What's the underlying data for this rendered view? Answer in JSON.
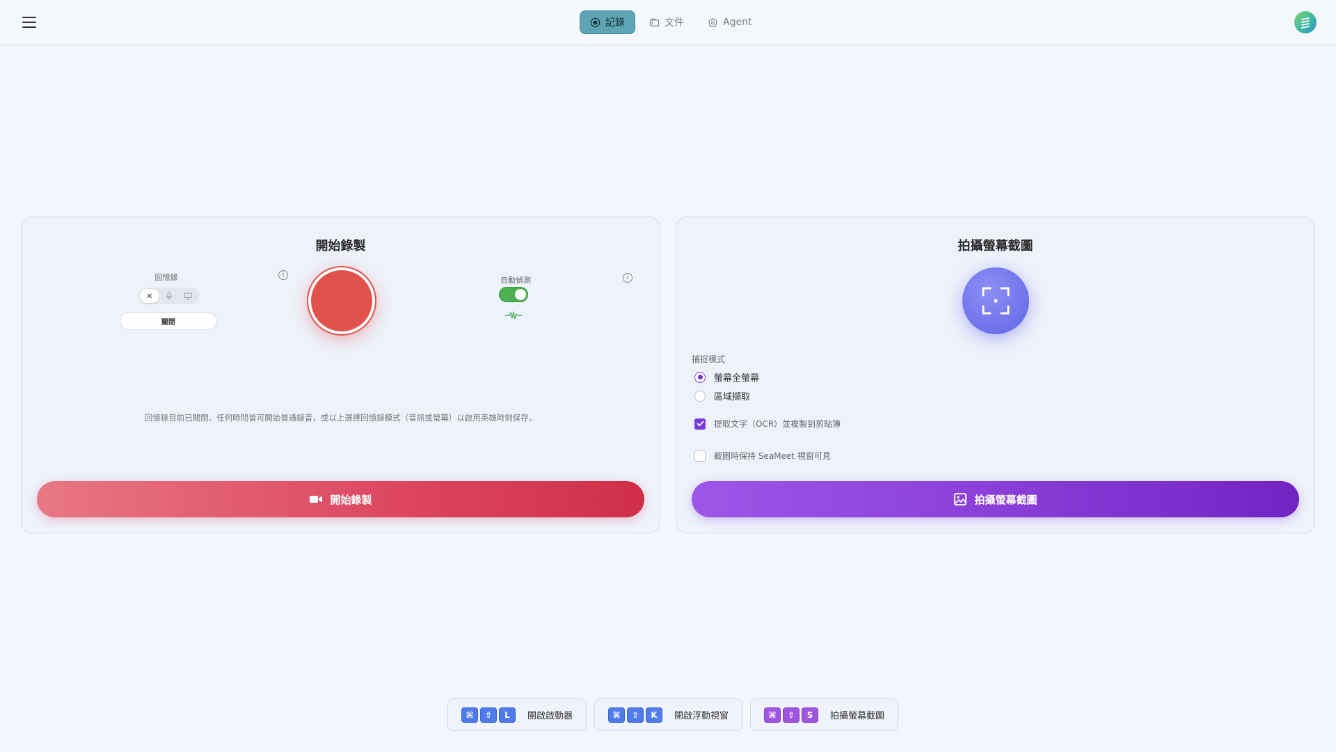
{
  "header": {
    "tabs": [
      {
        "label": "記錄",
        "icon": "record-icon",
        "active": true
      },
      {
        "label": "文件",
        "icon": "folder-icon",
        "active": false
      },
      {
        "label": "Agent",
        "icon": "agent-icon",
        "active": false
      }
    ],
    "menu_icon": "hamburger-menu-icon",
    "avatar_icon": "app-logo-avatar"
  },
  "record_card": {
    "title": "開始錄製",
    "recall_label": "回憶錄",
    "recall_modes": [
      {
        "icon": "close-icon",
        "symbol": "✕",
        "selected": true
      },
      {
        "icon": "microphone-icon",
        "selected": false
      },
      {
        "icon": "monitor-icon",
        "selected": false
      }
    ],
    "recall_status": "關閉",
    "info_symbol": "i",
    "auto_detect_label": "自動偵測",
    "auto_detect_on": true,
    "description": "回憶錄目前已關閉。任何時間皆可開始普通錄音，或以上選擇回憶錄模式（音訊或螢幕）以啟用英雄時刻保存。",
    "button_label": "開始錄製"
  },
  "screenshot_card": {
    "title": "拍攝螢幕截圖",
    "capture_mode_label": "捕捉模式",
    "capture_modes": [
      {
        "label": "螢幕全螢幕",
        "selected": true
      },
      {
        "label": "區域擷取",
        "selected": false
      }
    ],
    "options": [
      {
        "label": "提取文字（OCR）並複製到剪貼簿",
        "checked": true
      },
      {
        "label": "截圖時保持 SeaMeet 視窗可見",
        "checked": false
      }
    ],
    "button_label": "拍攝螢幕截圖"
  },
  "shortcuts": [
    {
      "keys": [
        "⌘",
        "⇧",
        "L"
      ],
      "label": "開啟啟動器",
      "color": "blue"
    },
    {
      "keys": [
        "⌘",
        "⇧",
        "K"
      ],
      "label": "開啟浮動視窗",
      "color": "blue"
    },
    {
      "keys": [
        "⌘",
        "⇧",
        "S"
      ],
      "label": "拍攝螢幕截圖",
      "color": "violet"
    }
  ],
  "colors": {
    "accent_tab": "#5fa4b4",
    "record_red": "#e2524c",
    "screenshot_purple": "#7a37d8",
    "toggle_green": "#4caf50"
  }
}
